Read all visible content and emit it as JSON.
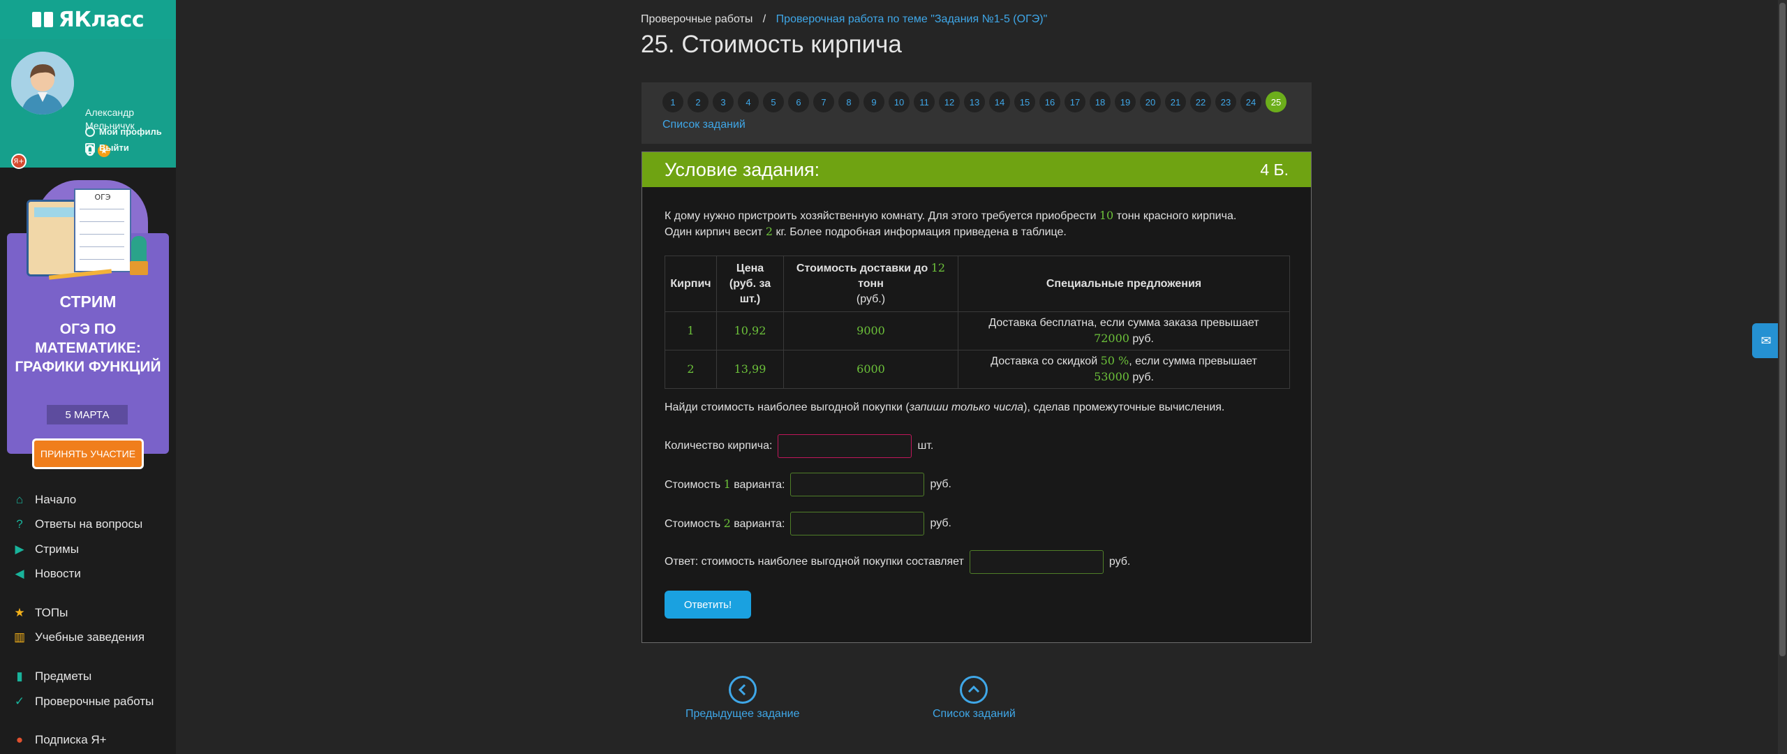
{
  "logo": {
    "text": "ЯКласс"
  },
  "user": {
    "name": "Александр Мельничук",
    "points": "0",
    "profile_label": "Мой профиль",
    "logout_label": "Выйти",
    "badge": "Я+"
  },
  "promo": {
    "paper_title": "ОГЭ",
    "title": "СТРИМ",
    "subtitle": "ОГЭ ПО МАТЕМАТИКЕ: ГРАФИКИ ФУНКЦИЙ",
    "date": "5 МАРТА",
    "button": "ПРИНЯТЬ УЧАСТИЕ"
  },
  "nav": [
    {
      "label": "Начало",
      "icon": "home-icon"
    },
    {
      "label": "Ответы на вопросы",
      "icon": "question-icon"
    },
    {
      "label": "Стримы",
      "icon": "play-icon"
    },
    {
      "label": "Новости",
      "icon": "megaphone-icon"
    },
    {
      "label": "ТОПы",
      "icon": "star-icon"
    },
    {
      "label": "Учебные заведения",
      "icon": "school-icon"
    },
    {
      "label": "Предметы",
      "icon": "books-icon"
    },
    {
      "label": "Проверочные работы",
      "icon": "check-icon"
    },
    {
      "label": "Подписка Я+",
      "icon": "subscription-icon"
    }
  ],
  "breadcrumb": {
    "first": "Проверочные работы",
    "separator": "/",
    "second": "Проверочная работа по теме \"Задания №1-5 (ОГЭ)\""
  },
  "page_title": "25. Стоимость кирпича",
  "task_numbers": [
    "1",
    "2",
    "3",
    "4",
    "5",
    "6",
    "7",
    "8",
    "9",
    "10",
    "11",
    "12",
    "13",
    "14",
    "15",
    "16",
    "17",
    "18",
    "19",
    "20",
    "21",
    "22",
    "23",
    "24",
    "25"
  ],
  "active_task": "25",
  "task_list_label": "Список заданий",
  "task": {
    "header": "Условие задания:",
    "points": "4 Б.",
    "text_p1a": "К дому нужно пристроить хозяйственную комнату. Для этого требуется приобрести",
    "text_tons": "10",
    "text_p1b": "тонн красного кирпича.",
    "text_p2a": "Один кирпич весит",
    "text_kg": "2",
    "text_p2b": "кг. Более подробная информация приведена в таблице."
  },
  "table": {
    "headers": {
      "brick": "Кирпич",
      "price": "Цена (руб. за шт.)",
      "delivery_a": "Стоимость доставки до",
      "delivery_num": "12",
      "delivery_b": "тонн",
      "delivery_c": "(руб.)",
      "offers": "Специальные предложения"
    },
    "rows": [
      {
        "brick": "1",
        "price": "10,92",
        "delivery": "9000",
        "offer_a": "Доставка бесплатна, если сумма заказа превышает",
        "offer_num": "72000",
        "offer_b": "руб."
      },
      {
        "brick": "2",
        "price": "13,99",
        "delivery": "6000",
        "offer_a": "Доставка со скидкой",
        "offer_pct": "50 %",
        "offer_mid": ", если сумма превышает",
        "offer_num": "53000",
        "offer_b": "руб."
      }
    ]
  },
  "find": {
    "a": "Найди стоимость наиболее выгодной покупки (",
    "italic": "запиши только числа",
    "b": "), сделав промежуточные вычисления."
  },
  "form": {
    "qty_label": "Количество кирпича:",
    "qty_unit": "шт.",
    "cost1_a": "Стоимость",
    "cost1_num": "1",
    "cost1_b": "варианта:",
    "cost2_a": "Стоимость",
    "cost2_num": "2",
    "cost2_b": "варианта:",
    "unit_rub": "руб.",
    "answer_label": "Ответ: стоимость наиболее выгодной покупки составляет",
    "submit": "Ответить!"
  },
  "bottom": {
    "prev": "Предыдущее задание",
    "list": "Список заданий"
  }
}
